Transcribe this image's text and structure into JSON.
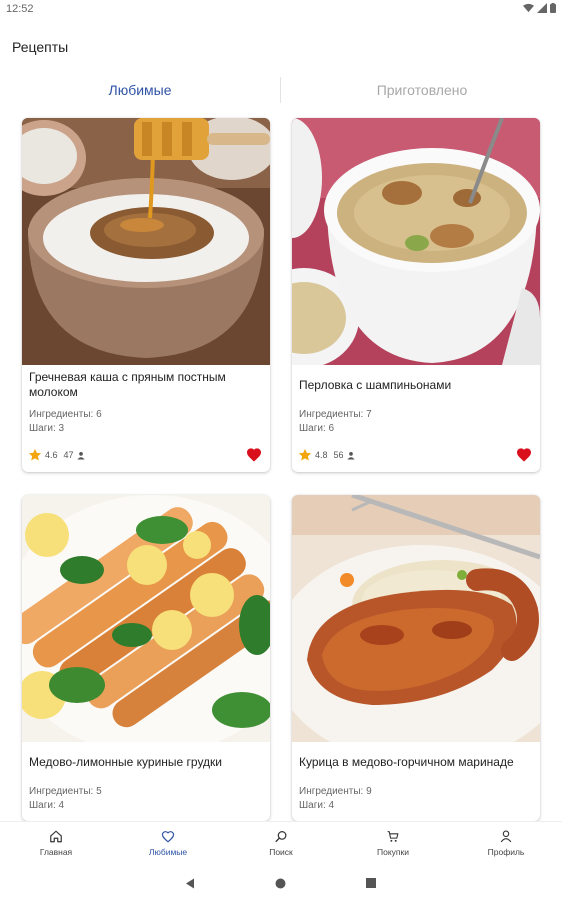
{
  "status_bar": {
    "time": "12:52"
  },
  "app_title": "Рецепты",
  "tabs": [
    {
      "label": "Любимые",
      "active": true
    },
    {
      "label": "Приготовлено",
      "active": false
    }
  ],
  "recipes": [
    {
      "title": "Гречневая каша с пряным постным молоком",
      "ingredients": "Ингредиенты: 6",
      "steps": "Шаги: 3",
      "rating": "4.6",
      "reviews": "47",
      "favorite": true
    },
    {
      "title": "Перловка с шампиньонами",
      "ingredients": "Ингредиенты: 7",
      "steps": "Шаги: 6",
      "rating": "4.8",
      "reviews": "56",
      "favorite": true
    },
    {
      "title": "Медово-лимонные куриные грудки",
      "ingredients": "Ингредиенты: 5",
      "steps": "Шаги: 4"
    },
    {
      "title": "Курица в медово-горчичном маринаде",
      "ingredients": "Ингредиенты: 9",
      "steps": "Шаги: 4"
    }
  ],
  "bottom_nav": [
    {
      "label": "Главная",
      "icon": "home-icon"
    },
    {
      "label": "Любимые",
      "icon": "heart-icon",
      "active": true
    },
    {
      "label": "Поиск",
      "icon": "search-icon"
    },
    {
      "label": "Покупки",
      "icon": "cart-icon"
    },
    {
      "label": "Профиль",
      "icon": "profile-icon"
    }
  ],
  "colors": {
    "accent": "#2f54a6",
    "heart": "#d90f1c",
    "star": "#f2a60c"
  }
}
